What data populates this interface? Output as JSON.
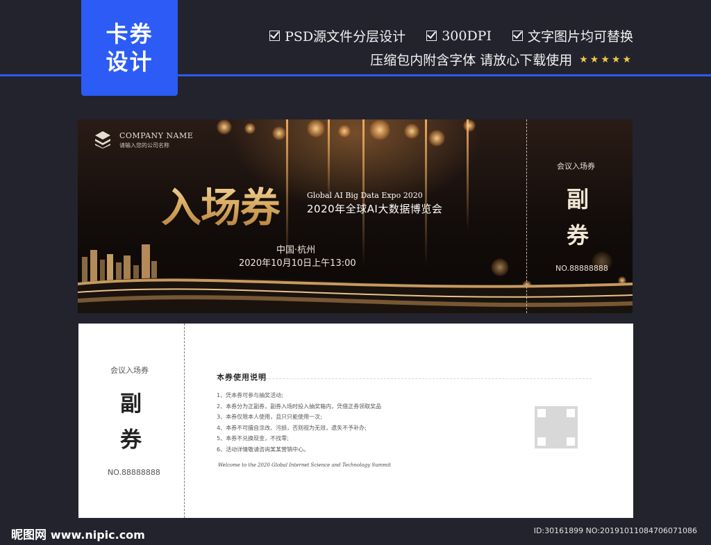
{
  "header": {
    "badge_line1": "卡券",
    "badge_line2": "设计",
    "features": [
      "PSD源文件分层设计",
      "300DPI",
      "文字图片均可替换"
    ],
    "sub_text": "压缩包内附含字体 请放心下载使用",
    "stars": "★★★★★",
    "colors": {
      "accent": "#2c5cf5",
      "background": "#22232d",
      "star": "#f2c94c"
    }
  },
  "ticket": {
    "company_name": "COMPANY NAME",
    "company_sub": "请输入您的公司名称",
    "title": "入场券",
    "expo_en": "Global AI Big Data Expo 2020",
    "expo_cn": "2020年全球AI大数据博览会",
    "location": "中国·杭州",
    "datetime": "2020年10月10日上午13:00",
    "stub_label": "会议入场券",
    "stub_char1": "副",
    "stub_char2": "券",
    "stub_no": "NO.88888888",
    "colors": {
      "gold": "#d9ab63",
      "dark": "#120c0a"
    }
  },
  "back": {
    "stub_label": "会议入场券",
    "stub_char1": "副",
    "stub_char2": "券",
    "stub_no": "NO.88888888",
    "rules_title": "本券使用说明",
    "rules": [
      "1、凭本券可参与抽奖活动;",
      "2、本券分为正副券，副券入场时投入抽奖箱内，凭借正券领取奖品",
      "3、本券仅限本人使用，且只只能使用一次;",
      "4、本券不可擅自涂改、污损，否则视为无效，遗失不予补办;",
      "5、本券不兑换现金，不找零;",
      "6、活动详情敬请咨询某某营销中心。"
    ],
    "welcome": "Welcome to the 2020 Global Internet Science and Technology Summit"
  },
  "footer": {
    "brand": "昵图网",
    "url": "www.nipic.com",
    "id_text": "ID:30161899 NO:20191011084706071086"
  }
}
